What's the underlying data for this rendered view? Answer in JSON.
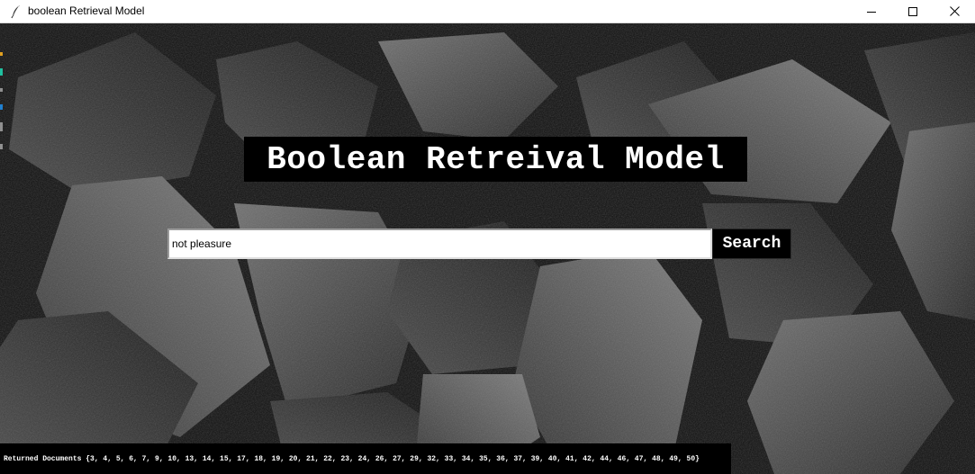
{
  "window": {
    "title": "boolean Retrieval Model",
    "app_icon": "feather-icon",
    "controls": {
      "minimize_icon": "minimize-icon",
      "maximize_icon": "maximize-icon",
      "close_icon": "close-icon"
    }
  },
  "main": {
    "background": "dark-rock-texture-image",
    "heading": "Boolean Retreival Model",
    "search": {
      "value": "not pleasure",
      "placeholder": ""
    },
    "search_button_label": "Search",
    "results_text": "Returned Documents {3, 4, 5, 6, 7, 9, 10, 13, 14, 15, 17, 18, 19, 20, 21, 22, 23, 24, 26, 27, 29, 32, 33, 34, 35, 36, 37, 39, 40, 41, 42, 44, 46, 47, 48, 49, 50}"
  },
  "colors": {
    "canvas_bg": "#121212",
    "heading_bg": "#000000",
    "heading_text": "#ffffff",
    "button_bg": "#000000",
    "results_bg": "#000000",
    "edge_marks": [
      "#e0a020",
      "#20c0a0",
      "#2080d0",
      "#909090"
    ]
  }
}
